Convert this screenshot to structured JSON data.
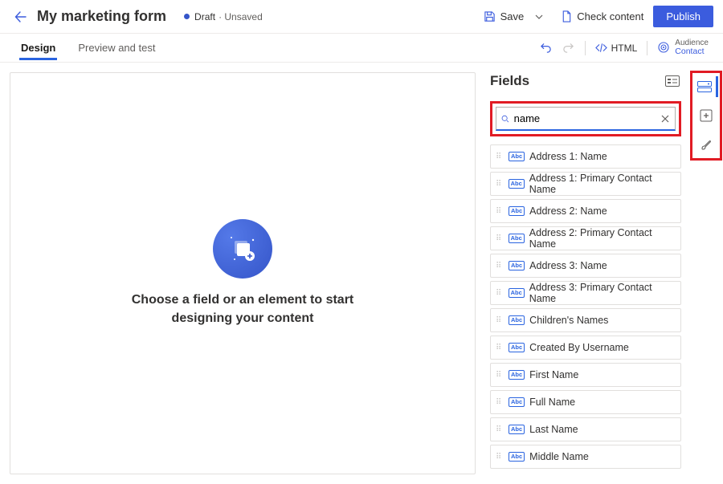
{
  "header": {
    "title": "My marketing form",
    "status_label": "Draft",
    "status_suffix": "· Unsaved",
    "save_label": "Save",
    "check_label": "Check content",
    "publish_label": "Publish"
  },
  "tabs": {
    "design": "Design",
    "preview": "Preview and test"
  },
  "toolbar": {
    "html_label": "HTML",
    "audience_top": "Audience",
    "audience_value": "Contact"
  },
  "canvas": {
    "empty_message": "Choose a field or an element to start designing your content"
  },
  "panel": {
    "title": "Fields",
    "search_value": "name",
    "fields": [
      "Address 1: Name",
      "Address 1: Primary Contact Name",
      "Address 2: Name",
      "Address 2: Primary Contact Name",
      "Address 3: Name",
      "Address 3: Primary Contact Name",
      "Children's Names",
      "Created By Username",
      "First Name",
      "Full Name",
      "Last Name",
      "Middle Name"
    ]
  }
}
